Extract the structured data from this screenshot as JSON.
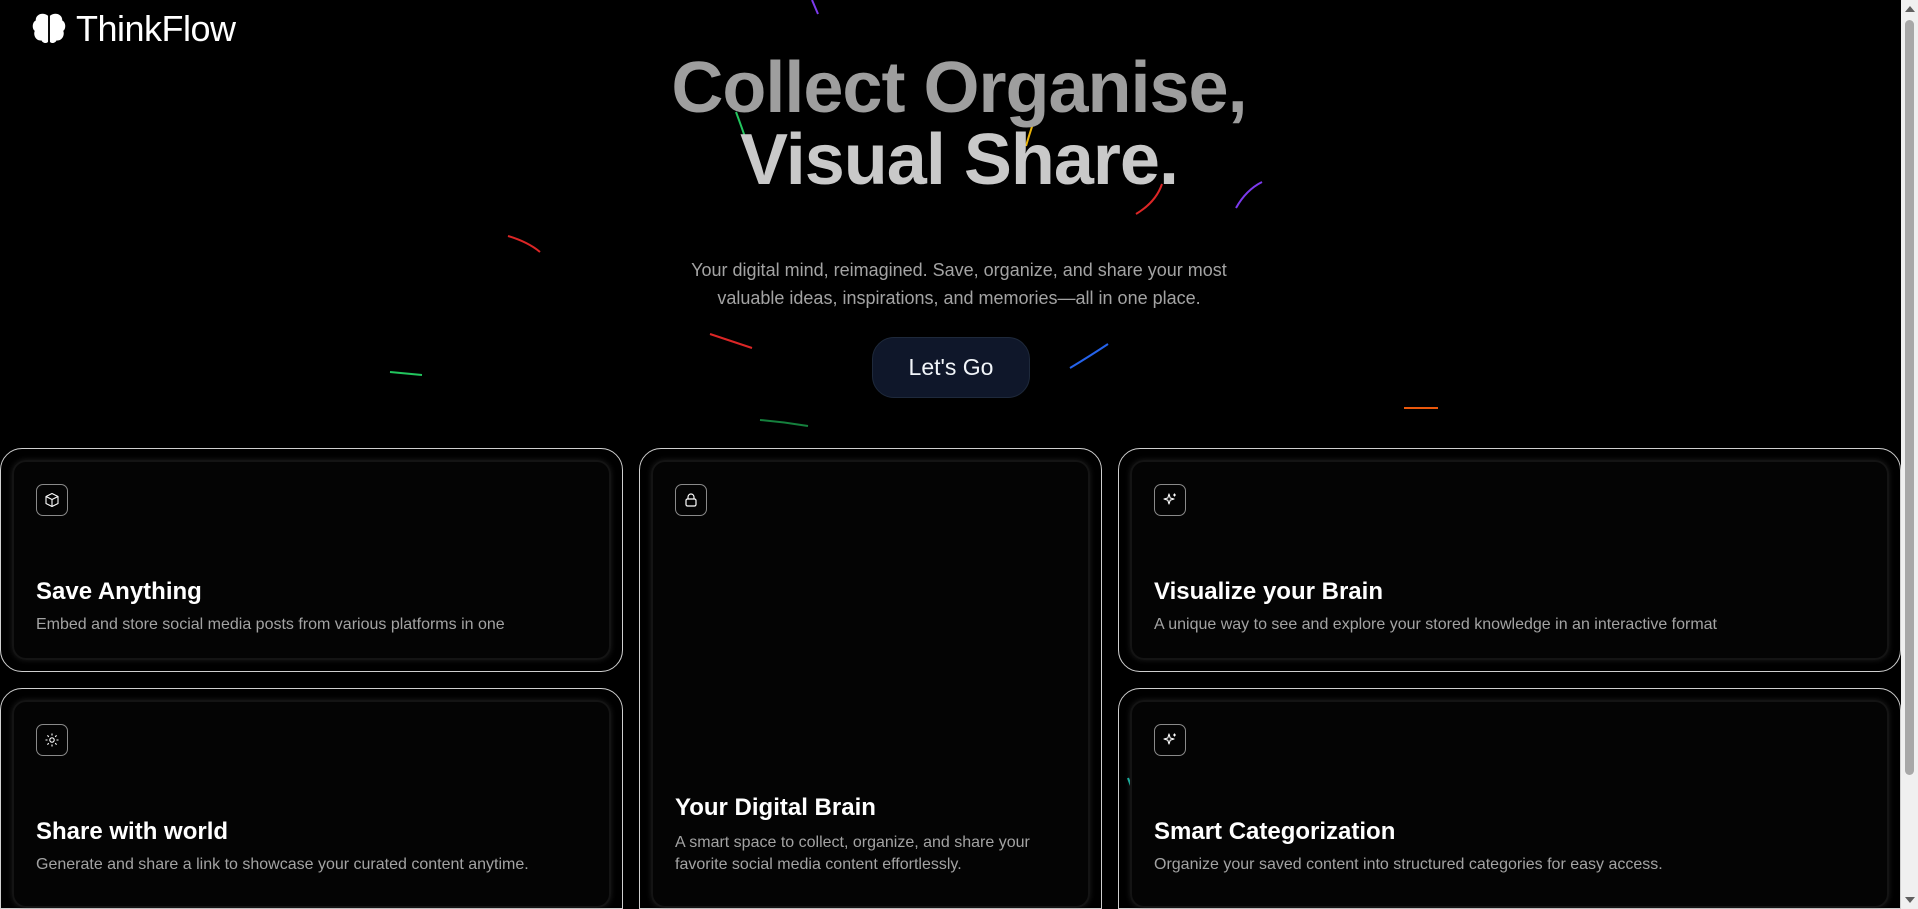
{
  "brand": {
    "name": "ThinkFlow",
    "logo_icon": "brain-icon"
  },
  "hero": {
    "title_line1": "Collect Organise,",
    "title_line2": "Visual Share.",
    "subtitle": "Your digital mind, reimagined. Save, organize, and share your most valuable ideas, inspirations, and memories—all in one place.",
    "cta_label": "Let's Go"
  },
  "features": [
    {
      "icon": "box-icon",
      "title": "Save Anything",
      "description": "Embed and store social media posts from various platforms in one"
    },
    {
      "icon": "lock-icon",
      "title": "Your Digital Brain",
      "description": "A smart space to collect, organize, and share your favorite social media content effortlessly."
    },
    {
      "icon": "sparkles-icon",
      "title": "Visualize your Brain",
      "description": "A unique way to see and explore your stored knowledge in an interactive format"
    },
    {
      "icon": "settings-icon",
      "title": "Share with world",
      "description": "Generate and share a link to showcase your curated content anytime."
    },
    {
      "icon": "sparkles-icon",
      "title": "Smart Categorization",
      "description": "Organize your saved content into structured categories for easy access."
    }
  ],
  "colors": {
    "background": "#000000",
    "cta_background": "#0f172a",
    "card_border": "#cfcfcf",
    "muted_text": "#a3a3a3"
  }
}
